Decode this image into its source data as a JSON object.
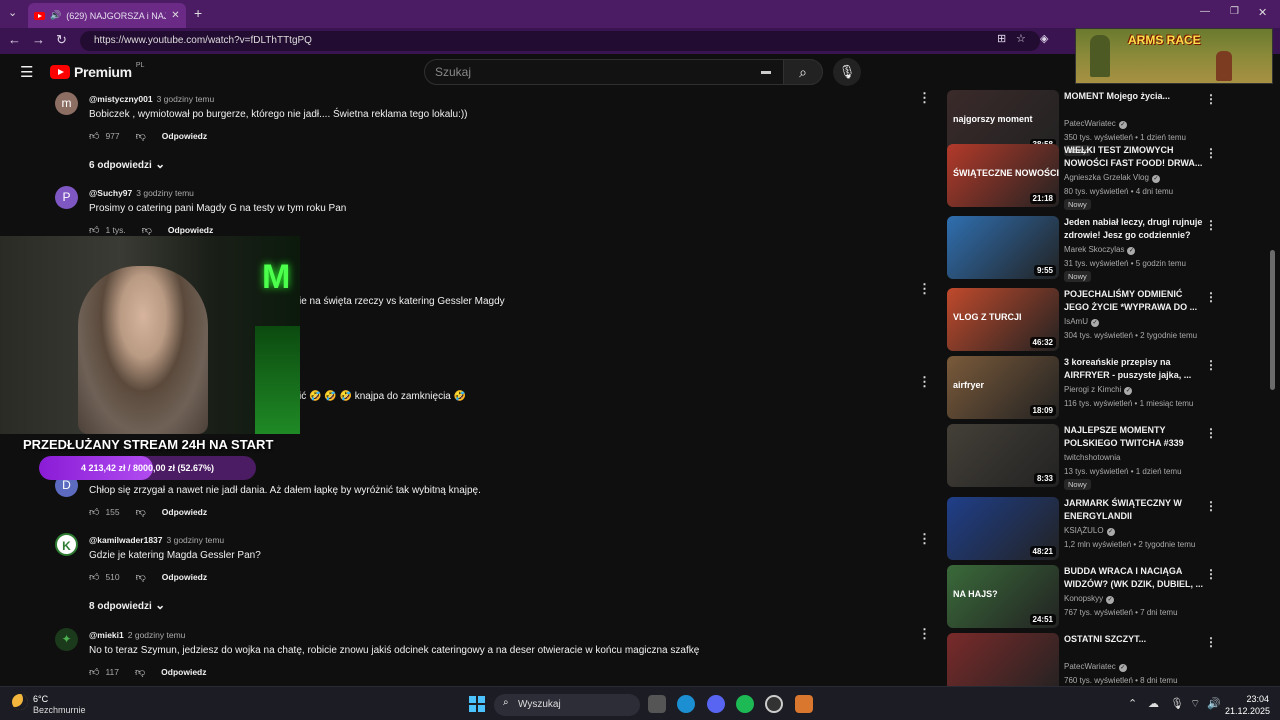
{
  "browser": {
    "tab_title": "(629) NAJGORSZA i NAJDROŻ",
    "url": "https://www.youtube.com/watch?v=fDLThTTtgPQ",
    "new_tab": "+"
  },
  "youtube": {
    "logo_text": "Premium",
    "logo_region": "PL",
    "search_placeholder": "Szukaj"
  },
  "comments": [
    {
      "avatar": "m",
      "avatar_color": "#8d6e63",
      "user": "@mistyczny001",
      "time": "3 godziny temu",
      "text": "Bobiczek , wymiotował po burgerze, którego nie jadł.... Świetna reklama tego lokalu:))",
      "likes": "977",
      "reply": "Odpowiedz",
      "replies": "6 odpowiedzi"
    },
    {
      "avatar": "P",
      "avatar_color": "#7e57c2",
      "user": "@Suchy97",
      "time": "3 godziny temu",
      "text": "Prosimy o catering pani Magdy G na testy w tym roku Pan",
      "likes": "1 tys.",
      "reply": "Odpowiedz"
    },
    {
      "text": "ie na święta rzeczy vs katering Gessler Magdy"
    },
    {
      "text": "ić 🤣 🤣 🤣 knajpa do zamknięcia 🤣"
    },
    {
      "avatar": "D",
      "avatar_color": "#5c6bc0",
      "text": "Chłop się zrzygał a nawet nie jadł dania. Aż dałem łapkę by wyróżnić tak wybitną knajpę.",
      "likes": "155",
      "reply": "Odpowiedz"
    },
    {
      "avatar": "K",
      "avatar_color": "#2e7d32",
      "user": "@kamilwader1837",
      "time": "3 godziny temu",
      "text": "Gdzie je katering Magda Gessler Pan?",
      "likes": "510",
      "reply": "Odpowiedz",
      "replies": "8 odpowiedzi"
    },
    {
      "avatar": "✦",
      "avatar_color": "#1b3a1b",
      "user": "@mieki1",
      "time": "2 godziny temu",
      "text": "No to teraz Szymun, jedziesz do wojka na chatę, robicie znowu jakiś odcinek cateringowy a na deser otwieracie w końcu magiczna szafkę",
      "likes": "117",
      "reply": "Odpowiedz"
    }
  ],
  "overlay": {
    "stream_banner": "PRZEDŁUŻANY STREAM 24H NA START",
    "donation_text": "4 213,42 zł / 8000,00 zł (52.67%)",
    "donation_progress": 0.5267,
    "cam_logo": "M",
    "game_title": "ARMS RACE"
  },
  "sidebar": [
    {
      "title": "MOMENT Mojego życia...",
      "channel": "PatecWariatec",
      "verified": true,
      "meta": "350 tys. wyświetleń • 1 dzień temu",
      "badge": "Nowy",
      "duration": "38:58",
      "thumb": "#3b2a2a",
      "thumb_text": "najgorszy moment"
    },
    {
      "title": "WIELKI TEST ZIMOWYCH NOWOŚCI FAST FOOD! DRWA...",
      "channel": "Agnieszka Grzelak Vlog",
      "verified": true,
      "meta": "80 tys. wyświetleń • 4 dni temu",
      "badge": "Nowy",
      "duration": "21:18",
      "thumb": "#b33a2a",
      "thumb_text": "ŚWIĄTECZNE NOWOŚCI"
    },
    {
      "title": "Jeden nabiał leczy, drugi rujnuje zdrowie! Jesz go codziennie?",
      "channel": "Marek Skoczylas",
      "verified": true,
      "meta": "31 tys. wyświetleń • 5 godzin temu",
      "badge": "Nowy",
      "duration": "9:55",
      "thumb": "#2f6fb0",
      "thumb_text": ""
    },
    {
      "title": "POJECHALIŚMY ODMIENIĆ JEGO ŻYCIE *WYPRAWA DO ...",
      "channel": "IsAmU",
      "verified": true,
      "meta": "304 tys. wyświetleń • 2 tygodnie temu",
      "duration": "46:32",
      "thumb": "#c04a2c",
      "thumb_text": "VLOG Z TURCJI"
    },
    {
      "title": "3 koreańskie przepisy na AIRFRYER - puszyste jajka, ...",
      "channel": "Pierogi z Kimchi",
      "verified": true,
      "meta": "116 tys. wyświetleń • 1 miesiąc temu",
      "duration": "18:09",
      "thumb": "#7a5a3a",
      "thumb_text": "airfryer"
    },
    {
      "title": "NAJLEPSZE MOMENTY POLSKIEGO TWITCHA #339",
      "channel": "twitchshotownia",
      "verified": false,
      "meta": "13 tys. wyświetleń • 1 dzień temu",
      "badge": "Nowy",
      "duration": "8:33",
      "thumb": "#444038",
      "thumb_text": ""
    },
    {
      "title": "JARMARK ŚWIĄTECZNY W ENERGYLANDII",
      "channel": "KSIĄŻULO",
      "verified": true,
      "meta": "1,2 mln wyświetleń • 2 tygodnie temu",
      "duration": "48:21",
      "thumb": "#1f3f8a",
      "thumb_text": ""
    },
    {
      "title": "BUDDA WRACA I NACIĄGA WIDZÓW? (WK DZIK, DUBIEL, ...",
      "channel": "Konopskyy",
      "verified": true,
      "meta": "767 tys. wyświetleń • 7 dni temu",
      "duration": "24:51",
      "thumb": "#3a6a3a",
      "thumb_text": "NA HAJS?"
    },
    {
      "title": "OSTATNI SZCZYT...",
      "channel": "PatecWariatec",
      "verified": true,
      "meta": "760 tys. wyświetleń • 8 dni temu",
      "duration": "",
      "thumb": "#7a2a2a",
      "thumb_text": ""
    }
  ],
  "taskbar": {
    "weather_temp": "6°C",
    "weather_desc": "Bezchmurnie",
    "search_label": "Wyszukaj",
    "time": "23:04",
    "date": "21.12.2025"
  }
}
